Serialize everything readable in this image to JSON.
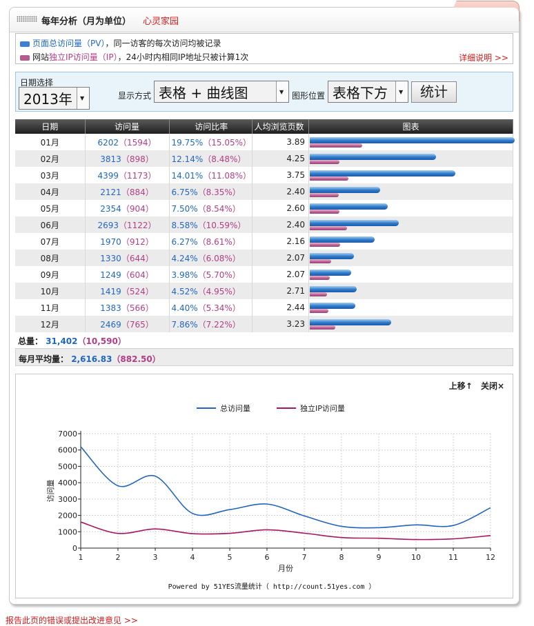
{
  "header": {
    "title": "每年分析（月为单位）",
    "site": "心灵家园"
  },
  "legend": {
    "pv_prefix": "页面总访问量（PV）",
    "pv_suffix": "，同一访客的每次访问均被记录",
    "ip_prefix": "网站",
    "ip_highlight": "独立IP访问量（IP）",
    "ip_suffix": "，24小时内相同IP地址只被计算1次",
    "detail_link": "详细说明 >>"
  },
  "filter": {
    "date_label": "日期选择",
    "year": "2013年",
    "display_label": "显示方式",
    "display_value": "表格 + 曲线图",
    "position_label": "图形位置",
    "position_value": "表格下方",
    "submit": "统计"
  },
  "table": {
    "headers": [
      "日期",
      "访问量",
      "访问比率",
      "人均浏览页数",
      "图表"
    ],
    "rows": [
      {
        "month": "01月",
        "pv": "6202",
        "ip": "（1594）",
        "pv_ratio": "19.75%",
        "ip_ratio": "（15.05%）",
        "avg": "3.89",
        "pv_n": 6202,
        "ip_n": 1594
      },
      {
        "month": "02月",
        "pv": "3813",
        "ip": "（898）",
        "pv_ratio": "12.14%",
        "ip_ratio": "（8.48%）",
        "avg": "4.25",
        "pv_n": 3813,
        "ip_n": 898
      },
      {
        "month": "03月",
        "pv": "4399",
        "ip": "（1173）",
        "pv_ratio": "14.01%",
        "ip_ratio": "（11.08%）",
        "avg": "3.75",
        "pv_n": 4399,
        "ip_n": 1173
      },
      {
        "month": "04月",
        "pv": "2121",
        "ip": "（884）",
        "pv_ratio": "6.75%",
        "ip_ratio": "（8.35%）",
        "avg": "2.40",
        "pv_n": 2121,
        "ip_n": 884
      },
      {
        "month": "05月",
        "pv": "2354",
        "ip": "（904）",
        "pv_ratio": "7.50%",
        "ip_ratio": "（8.54%）",
        "avg": "2.60",
        "pv_n": 2354,
        "ip_n": 904
      },
      {
        "month": "06月",
        "pv": "2693",
        "ip": "（1122）",
        "pv_ratio": "8.58%",
        "ip_ratio": "（10.59%）",
        "avg": "2.40",
        "pv_n": 2693,
        "ip_n": 1122
      },
      {
        "month": "07月",
        "pv": "1970",
        "ip": "（912）",
        "pv_ratio": "6.27%",
        "ip_ratio": "（8.61%）",
        "avg": "2.16",
        "pv_n": 1970,
        "ip_n": 912
      },
      {
        "month": "08月",
        "pv": "1330",
        "ip": "（644）",
        "pv_ratio": "4.24%",
        "ip_ratio": "（6.08%）",
        "avg": "2.07",
        "pv_n": 1330,
        "ip_n": 644
      },
      {
        "month": "09月",
        "pv": "1249",
        "ip": "（604）",
        "pv_ratio": "3.98%",
        "ip_ratio": "（5.70%）",
        "avg": "2.07",
        "pv_n": 1249,
        "ip_n": 604
      },
      {
        "month": "10月",
        "pv": "1419",
        "ip": "（524）",
        "pv_ratio": "4.52%",
        "ip_ratio": "（4.95%）",
        "avg": "2.71",
        "pv_n": 1419,
        "ip_n": 524
      },
      {
        "month": "11月",
        "pv": "1383",
        "ip": "（566）",
        "pv_ratio": "4.40%",
        "ip_ratio": "（5.34%）",
        "avg": "2.44",
        "pv_n": 1383,
        "ip_n": 566
      },
      {
        "month": "12月",
        "pv": "2469",
        "ip": "（765）",
        "pv_ratio": "7.86%",
        "ip_ratio": "（7.22%）",
        "avg": "3.23",
        "pv_n": 2469,
        "ip_n": 765
      }
    ]
  },
  "totals": {
    "label": "总量：",
    "pv": "31,402",
    "ip": "（10,590）"
  },
  "monthly_avg": {
    "label": "每月平均量：",
    "pv": "2,616.83",
    "ip": "（882.50）"
  },
  "chart_controls": {
    "up": "上移↑",
    "close": "关闭×"
  },
  "chart_data": {
    "type": "line",
    "x": [
      1,
      2,
      3,
      4,
      5,
      6,
      7,
      8,
      9,
      10,
      11,
      12
    ],
    "series": [
      {
        "name": "总访问量",
        "color": "#1f64c0",
        "values": [
          6202,
          3813,
          4399,
          2121,
          2354,
          2693,
          1970,
          1330,
          1249,
          1419,
          1383,
          2469
        ]
      },
      {
        "name": "独立IP访问量",
        "color": "#a81660",
        "values": [
          1594,
          898,
          1173,
          884,
          904,
          1122,
          912,
          644,
          604,
          524,
          566,
          765
        ]
      }
    ],
    "yticks": [
      "0",
      "1000",
      "2000",
      "3000",
      "4000",
      "5000",
      "6000",
      "7000"
    ],
    "xticks": [
      "1",
      "2",
      "3",
      "4",
      "5",
      "6",
      "7",
      "8",
      "9",
      "10",
      "11",
      "12"
    ],
    "ylim": [
      0,
      7000
    ],
    "xlabel": "月份",
    "ylabel": "访问量",
    "grid": true,
    "legend_position": "top"
  },
  "powered": "Powered by 51YES流量统计（ http://count.51yes.com ）",
  "footer": {
    "feedback": "报告此页的错误或提出改进意见 >>"
  },
  "colors": {
    "pv": "#1f67c5",
    "ip": "#b43d85",
    "link": "#d41919"
  }
}
